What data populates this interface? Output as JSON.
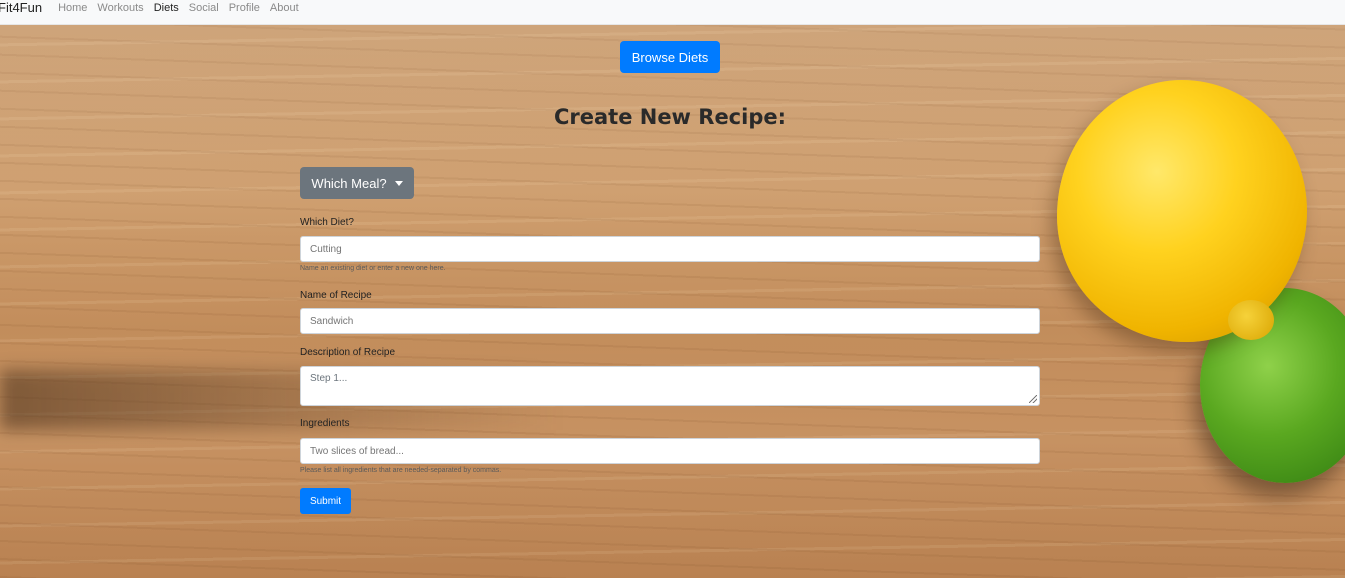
{
  "nav": {
    "brand": "Fit4Fun",
    "links": [
      "Home",
      "Workouts",
      "Diets",
      "Social",
      "Profile",
      "About"
    ],
    "active": "Diets"
  },
  "browse_button": "Browse Diets",
  "title": "Create New Recipe:",
  "meal_dropdown": "Which Meal?",
  "form": {
    "diet_label": "Which Diet?",
    "diet_placeholder": "Cutting",
    "diet_help": "Name an existing diet or enter a new one here.",
    "recipe_label": "Name of Recipe",
    "recipe_placeholder": "Sandwich",
    "description_label": "Description of Recipe",
    "description_placeholder": "Step 1...",
    "ingredients_label": "Ingredients",
    "ingredients_placeholder": "Two slices of bread...",
    "ingredients_help": "Please list all ingredients that are needed-separated by commas.",
    "submit": "Submit"
  },
  "colors": {
    "primary": "#007bff",
    "secondary": "#6c757d",
    "navbar": "#f8f9fa"
  }
}
